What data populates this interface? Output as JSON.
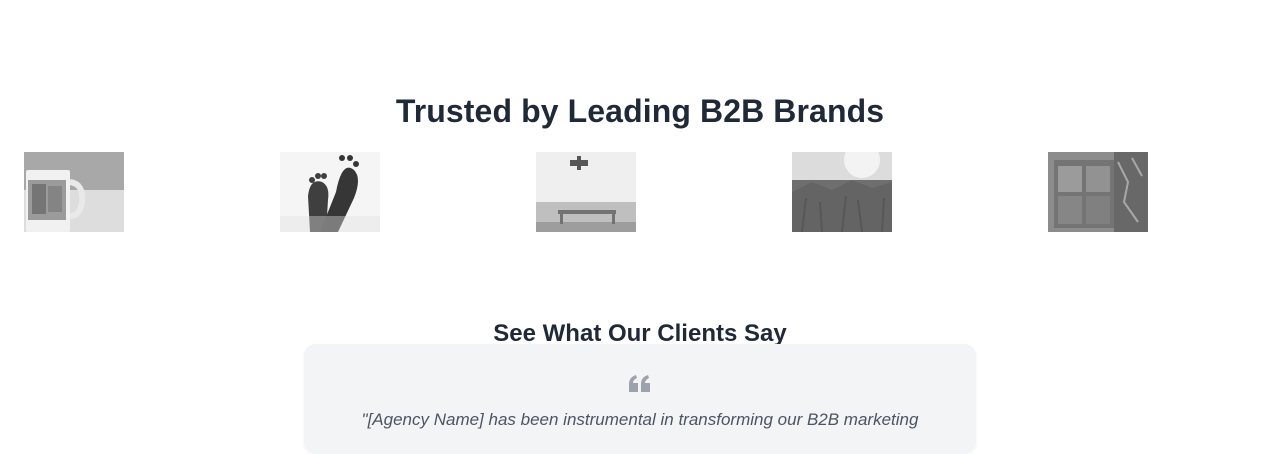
{
  "brands_section": {
    "title": "Trusted by Leading B2B Brands",
    "logos": [
      {
        "name": "mug-photo-logo"
      },
      {
        "name": "feet-photo-logo"
      },
      {
        "name": "bench-photo-logo"
      },
      {
        "name": "field-photo-logo"
      },
      {
        "name": "shed-photo-logo"
      }
    ]
  },
  "testimonials_section": {
    "title": "See What Our Clients Say",
    "quote_icon": "quote-icon",
    "quote_text": "\"[Agency Name] has been instrumental in transforming our B2B marketing"
  },
  "colors": {
    "heading": "#1f2937",
    "card_background": "#f3f4f6",
    "quote_icon": "#9ca3af",
    "quote_text": "#4b5563"
  }
}
